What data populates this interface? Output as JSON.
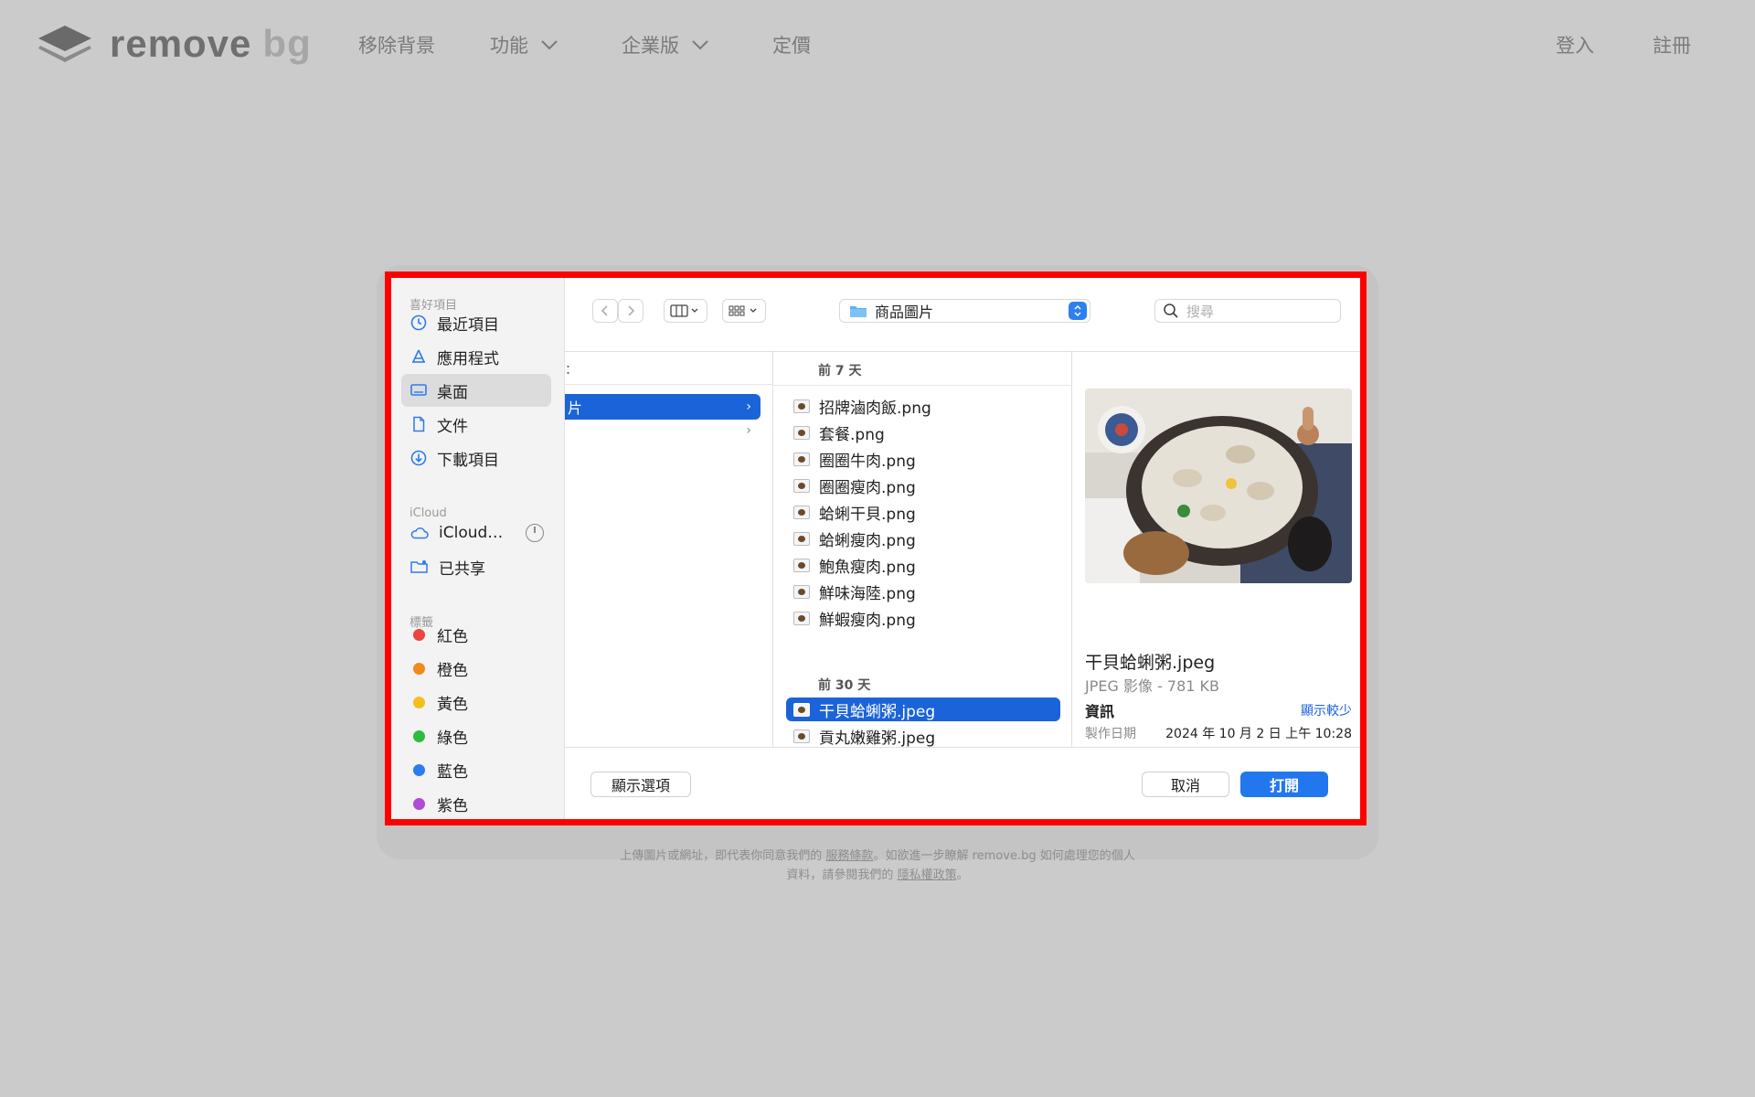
{
  "site": {
    "logo_primary": "remove",
    "logo_secondary": "bg",
    "nav": [
      {
        "label": "移除背景"
      },
      {
        "label": "功能"
      },
      {
        "label": "企業版"
      },
      {
        "label": "定價"
      }
    ],
    "login": "登入",
    "signup": "註冊"
  },
  "dialog": {
    "sidebar": {
      "favorites_title": "喜好項目",
      "favorites": [
        {
          "label": "最近項目",
          "icon": "clock-icon"
        },
        {
          "label": "應用程式",
          "icon": "apps-icon"
        },
        {
          "label": "桌面",
          "icon": "desktop-icon",
          "active": true
        },
        {
          "label": "文件",
          "icon": "document-icon"
        },
        {
          "label": "下載項目",
          "icon": "download-icon"
        }
      ],
      "icloud_title": "iCloud",
      "icloud": [
        {
          "label": "iCloud…",
          "icon": "cloud-icon"
        },
        {
          "label": "已共享",
          "icon": "shared-folder-icon"
        }
      ],
      "tags_title": "標籤",
      "tags": [
        {
          "label": "紅色",
          "color": "#e8463f"
        },
        {
          "label": "橙色",
          "color": "#f0891e"
        },
        {
          "label": "黃色",
          "color": "#f2c01e"
        },
        {
          "label": "綠色",
          "color": "#2ebb3f"
        },
        {
          "label": "藍色",
          "color": "#2c7bf0"
        },
        {
          "label": "紫色",
          "color": "#b04ad8"
        }
      ]
    },
    "toolbar": {
      "folder": "商品圖片",
      "search_placeholder": "搜尋"
    },
    "column1": {
      "header_fragment": "：",
      "selected_fragment": "片"
    },
    "files": {
      "group1": "前 7 天",
      "group1_items": [
        "招牌滷肉飯.png",
        "套餐.png",
        "圈圈牛肉.png",
        "圈圈瘦肉.png",
        "蛤蜊干貝.png",
        "蛤蜊瘦肉.png",
        "鮑魚瘦肉.png",
        "鮮味海陸.png",
        "鮮蝦瘦肉.png"
      ],
      "group2": "前 30 天",
      "group2_items": [
        "干貝蛤蜊粥.jpeg",
        "貢丸嫩雞粥.jpeg"
      ],
      "selected": "干貝蛤蜊粥.jpeg"
    },
    "preview": {
      "name": "干貝蛤蜊粥.jpeg",
      "kind": "JPEG 影像 - 781 KB",
      "info_label": "資訊",
      "show_less": "顯示較少",
      "created_label": "製作日期",
      "created_value": "2024 年 10 月 2 日 上午 10:28"
    },
    "buttons": {
      "options": "顯示選項",
      "cancel": "取消",
      "open": "打開"
    }
  },
  "legal": {
    "line1_a": "上傳圖片或網址，即代表你同意我們的",
    "terms": "服務條款",
    "line1_b": "。如欲進一步瞭解 remove.bg 如何處理您的個人",
    "line2_a": "資料，請參閱我們的",
    "privacy": "隱私權政策",
    "line2_b": "。"
  }
}
